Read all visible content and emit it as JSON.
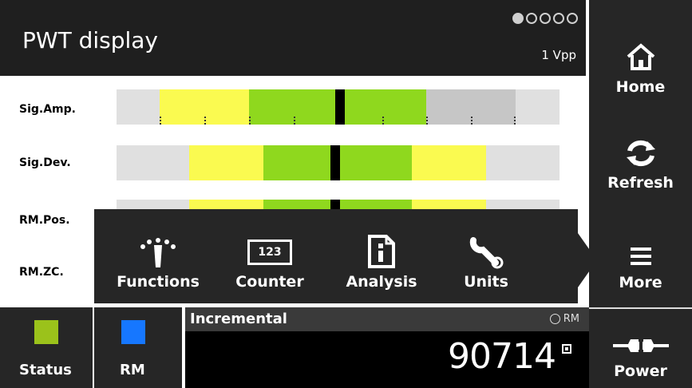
{
  "header": {
    "title": "PWT display",
    "subtitle": "1 Vpp",
    "page_dots": {
      "total": 5,
      "active": 1
    }
  },
  "nav": {
    "home_label": "Home",
    "refresh_label": "Refresh",
    "more_label": "More",
    "power_label": "Power"
  },
  "signals": [
    {
      "label": "Sig.Amp."
    },
    {
      "label": "Sig.Dev."
    },
    {
      "label": "RM.Pos."
    },
    {
      "label": "RM.ZC."
    }
  ],
  "popup": {
    "functions_label": "Functions",
    "counter_label": "Counter",
    "counter_icon_text": "123",
    "analysis_label": "Analysis",
    "units_label": "Units"
  },
  "bottom": {
    "status_label": "Status",
    "status_color": "#9bc21b",
    "rm_label": "RM",
    "rm_color": "#1677ff",
    "mode_label": "Incremental",
    "rm_indicator": "RM",
    "count_value": "90714"
  },
  "colors": {
    "yellow": "#fafa50",
    "green": "#8fd81e",
    "gray": "#c6c6c6",
    "dark": "#262626"
  }
}
